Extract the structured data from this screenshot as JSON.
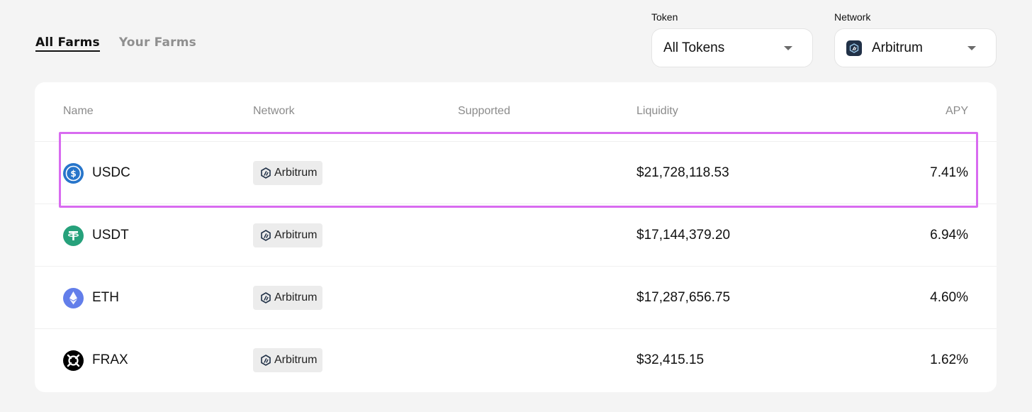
{
  "tabs": [
    {
      "label": "All Farms",
      "active": true
    },
    {
      "label": "Your Farms",
      "active": false
    }
  ],
  "filters": {
    "token": {
      "label": "Token",
      "value": "All Tokens"
    },
    "network": {
      "label": "Network",
      "value": "Arbitrum",
      "icon": "arbitrum-icon"
    }
  },
  "table": {
    "headers": {
      "name": "Name",
      "network": "Network",
      "supported": "Supported",
      "liquidity": "Liquidity",
      "apy": "APY"
    },
    "rows": [
      {
        "name": "USDC",
        "icon": "usdc-icon",
        "icon_color": "#2775ca",
        "network": "Arbitrum",
        "supported": "",
        "liquidity": "$21,728,118.53",
        "apy": "7.41%",
        "highlighted": true
      },
      {
        "name": "USDT",
        "icon": "usdt-icon",
        "icon_color": "#26a17b",
        "network": "Arbitrum",
        "supported": "",
        "liquidity": "$17,144,379.20",
        "apy": "6.94%",
        "highlighted": false
      },
      {
        "name": "ETH",
        "icon": "eth-icon",
        "icon_color": "#627eea",
        "network": "Arbitrum",
        "supported": "",
        "liquidity": "$17,287,656.75",
        "apy": "4.60%",
        "highlighted": false
      },
      {
        "name": "FRAX",
        "icon": "frax-icon",
        "icon_color": "#000000",
        "network": "Arbitrum",
        "supported": "",
        "liquidity": "$32,415.15",
        "apy": "1.62%",
        "highlighted": false
      }
    ]
  },
  "colors": {
    "background": "#f4f4f4",
    "card": "#ffffff",
    "highlight": "#d86bf0",
    "arbitrum": "#213147"
  }
}
